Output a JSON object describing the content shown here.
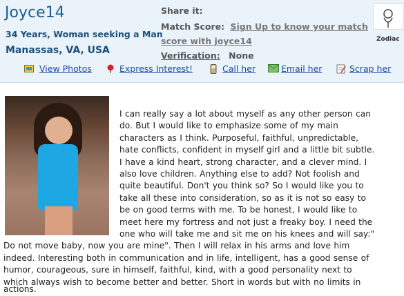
{
  "profile": {
    "name": "Joyce14",
    "summary": "34 Years, Woman seeking a Man",
    "location": "Manassas, VA, USA"
  },
  "info": {
    "share_label": "Share it:",
    "match_label": "Match Score:",
    "match_link_line1": "Sign Up to know your match",
    "match_link_line2": "score with joyce14",
    "verification_label": "Verification:",
    "verification_value": "None",
    "zodiac_label": "Zodiac"
  },
  "actions": {
    "view_photos": "View Photos",
    "express_interest": "Express Interest!",
    "call_her": "Call her",
    "email_her": "Email her",
    "scrap_her": "Scrap her"
  },
  "bio": {
    "lines_right": [
      "I can really say a lot about myself as any other person can",
      "do. But I would like to emphasize some of my main",
      "characters as I think. Purposeful, faithful, unpredictable,",
      "hate conflicts, confident in myself girl and a little bit subtle.",
      "I have a kind heart, strong character, and a clever mind. I",
      "also love children. Anything else to add? Not foolish and",
      "quite beautiful. Don't you think so? So I would like you to",
      "take all these into consideration, so as it is not so easy to",
      "be on good terms with me. To be honest, I would like to",
      "meet here my fortress and not just a freaky boy. I need the",
      "one who will take me and sit me on his knees and will say:\""
    ],
    "lines_full": [
      "Do not move baby, now you are mine\". Then I will relax in his arms and love him",
      "indeed. Interesting both in communication and in life, intelligent, has a good sense of",
      "humor, courageous, sure in himself, faithful, kind, with a good personality next to",
      "which always wish to become better and better. Short in words but with no limits in",
      "actions."
    ]
  },
  "colors": {
    "header_bg": "#eaf3fa",
    "name_color": "#1b5c92",
    "link_color": "#1a47a8"
  }
}
